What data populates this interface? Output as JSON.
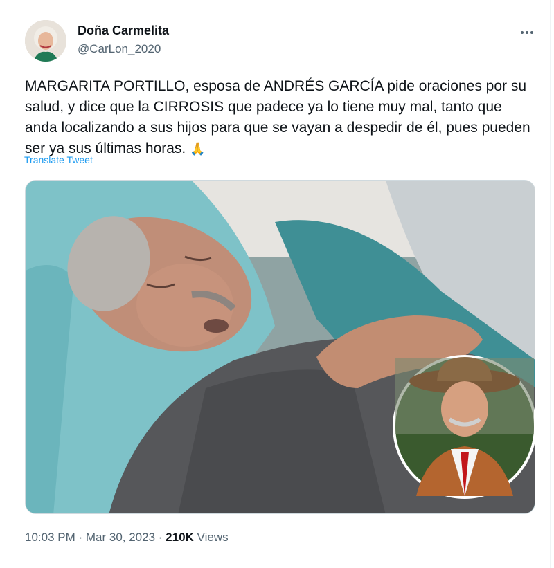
{
  "author": {
    "display_name": "Doña Carmelita",
    "handle": "@CarLon_2020"
  },
  "tweet": {
    "text": "MARGARITA PORTILLO, esposa de ANDRÉS GARCÍA pide oraciones por su salud, y dice que la CIRROSIS que padece ya lo tiene muy mal, tanto que anda localizando a sus hijos para que se vayan a despedir de él, pues pueden ser ya sus últimas horas.",
    "emoji": "🙏",
    "translate_label": "Translate Tweet"
  },
  "meta": {
    "time": "10:03 PM",
    "separator1": " · ",
    "date": "Mar 30, 2023",
    "separator2": " · ",
    "views_count": "210K",
    "views_label": " Views"
  },
  "icons": {
    "more": "more-options-icon",
    "emoji": "folded-hands-emoji"
  },
  "colors": {
    "text_primary": "#0f1419",
    "text_secondary": "#536471",
    "link": "#1d9bf0",
    "border": "#cfd9de"
  }
}
